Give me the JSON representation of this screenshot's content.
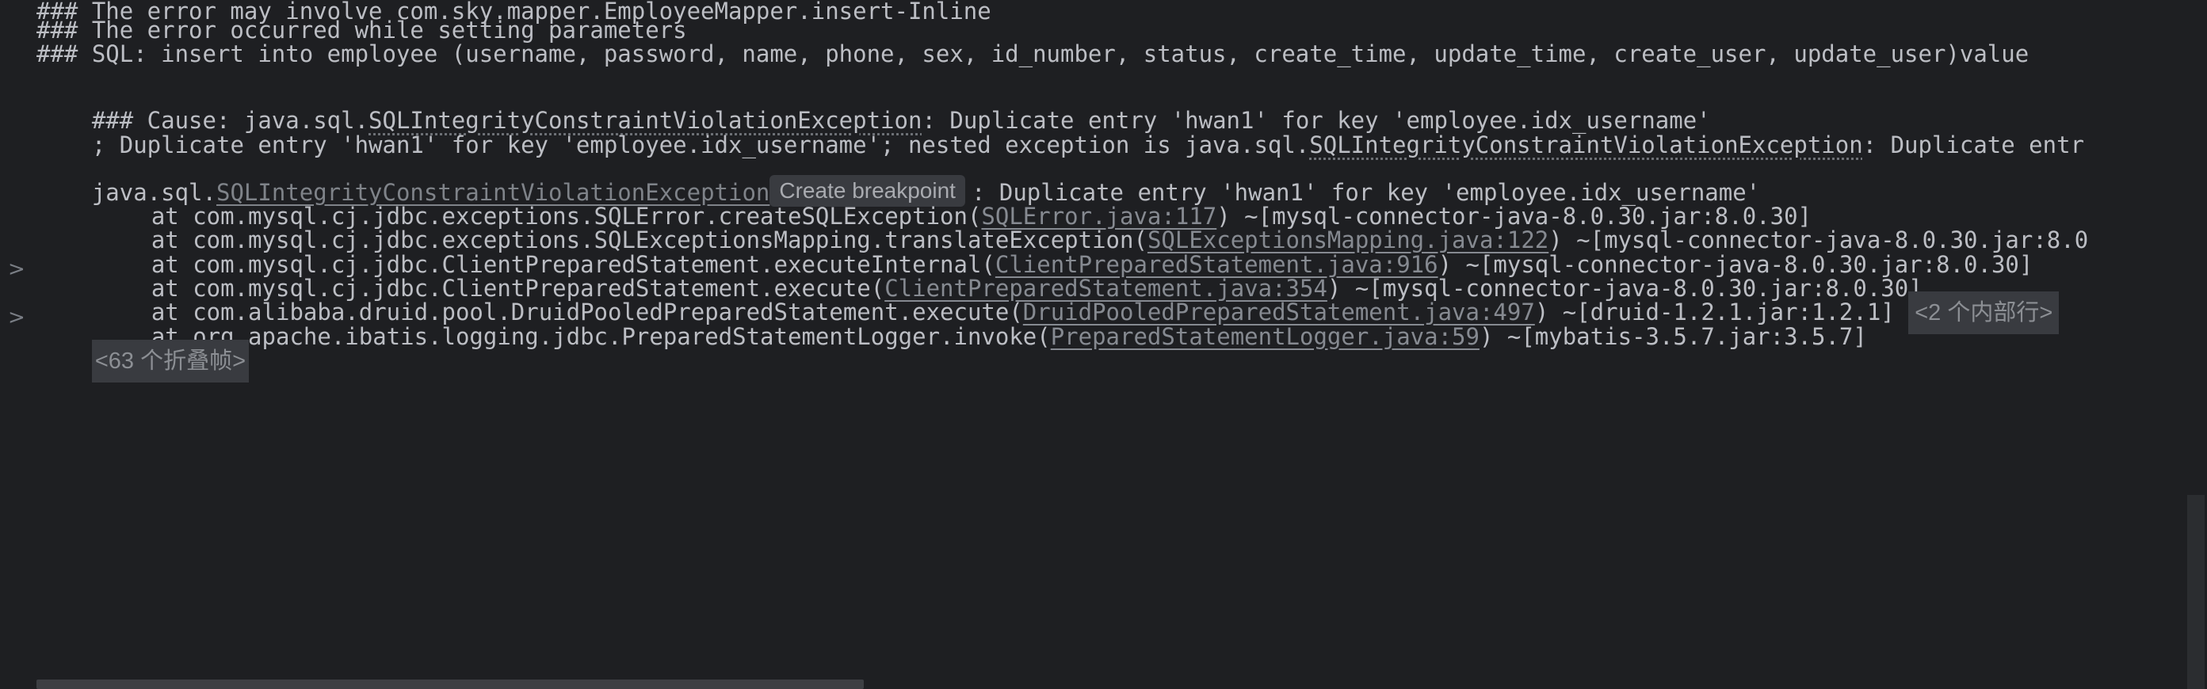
{
  "console": {
    "line1": "### The error may involve com.sky.mapper.EmployeeMapper.insert-Inline",
    "line2": "### The error occurred while setting parameters",
    "line3": "### SQL: insert into employee (username, password, name, phone, sex, id_number, status, create_time, update_time, create_user, update_user)value",
    "line4": {
      "prefix": "### Cause: java.sql.",
      "exception": "SQLIntegrityConstraintViolationException",
      "suffix": ": Duplicate entry 'hwan1' for key 'employee.idx_username'"
    },
    "line5": {
      "prefix": "; Duplicate entry 'hwan1' for key 'employee.idx_username'; nested exception is java.sql.",
      "exception": "SQLIntegrityConstraintViolationException",
      "suffix": ": Duplicate entr"
    },
    "exception_line": {
      "prefix": "java.sql.",
      "exception": "SQLIntegrityConstraintViolationException",
      "breakpoint_hint": "Create breakpoint",
      "suffix": ": Duplicate entry 'hwan1' for key 'employee.idx_username'"
    },
    "frames": [
      {
        "method": "at com.mysql.cj.jdbc.exceptions.SQLError.createSQLException(",
        "source": "SQLError.java:117",
        "jar": ") ~[mysql-connector-java-8.0.30.jar:8.0.30]"
      },
      {
        "method": "at com.mysql.cj.jdbc.exceptions.SQLExceptionsMapping.translateException(",
        "source": "SQLExceptionsMapping.java:122",
        "jar": ") ~[mysql-connector-java-8.0.30.jar:8.0"
      },
      {
        "method": "at com.mysql.cj.jdbc.ClientPreparedStatement.executeInternal(",
        "source": "ClientPreparedStatement.java:916",
        "jar": ") ~[mysql-connector-java-8.0.30.jar:8.0.30]"
      },
      {
        "method": "at com.mysql.cj.jdbc.ClientPreparedStatement.execute(",
        "source": "ClientPreparedStatement.java:354",
        "jar": ") ~[mysql-connector-java-8.0.30.jar:8.0.30]"
      },
      {
        "method": "at com.alibaba.druid.pool.DruidPooledPreparedStatement.execute(",
        "source": "DruidPooledPreparedStatement.java:497",
        "jar": ") ~[druid-1.2.1.jar:1.2.1]",
        "fold": "<2 个内部行>"
      },
      {
        "method": "at org.apache.ibatis.logging.jdbc.PreparedStatementLogger.invoke(",
        "source": "PreparedStatementLogger.java:59",
        "jar": ") ~[mybatis-3.5.7.jar:3.5.7]"
      }
    ],
    "folded_frames": "<63 个折叠帧>"
  },
  "gutter": {
    "expand_icon": "chevron-right-icon",
    "expand_glyph": ">"
  },
  "colors": {
    "background": "#1e1f22",
    "text": "#bcbec4",
    "link": "#868a91",
    "badge_bg": "#393b40"
  }
}
